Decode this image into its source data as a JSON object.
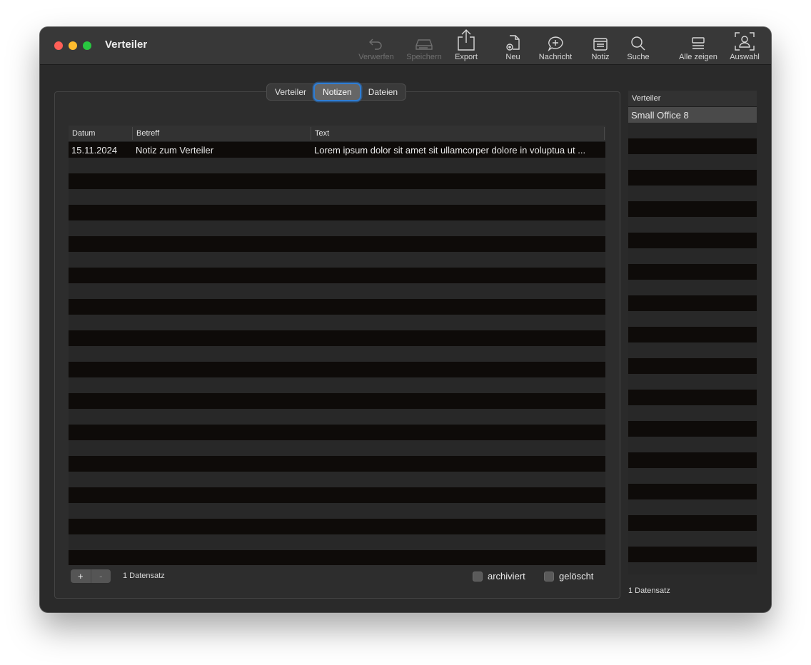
{
  "window": {
    "title": "Verteiler"
  },
  "toolbar": {
    "discard": "Verwerfen",
    "save": "Speichern",
    "export": "Export",
    "new": "Neu",
    "message": "Nachricht",
    "note": "Notiz",
    "search": "Suche",
    "show_all": "Alle zeigen",
    "selection": "Auswahl"
  },
  "tabs": {
    "verteiler": "Verteiler",
    "notizen": "Notizen",
    "dateien": "Dateien"
  },
  "notes_table": {
    "columns": {
      "date": "Datum",
      "subject": "Betreff",
      "text": "Text"
    },
    "rows": [
      {
        "date": "15.11.2024",
        "subject": "Notiz zum Verteiler",
        "text": "Lorem ipsum dolor sit amet sit ullamcorper dolore in voluptua ut ..."
      }
    ],
    "footer": {
      "add": "+",
      "remove": "-",
      "count": "1 Datensatz",
      "archived": "archiviert",
      "deleted": "gelöscht"
    }
  },
  "sidebar": {
    "header": "Verteiler",
    "rows": [
      {
        "name": "Small Office 8"
      }
    ],
    "count": "1 Datensatz"
  }
}
